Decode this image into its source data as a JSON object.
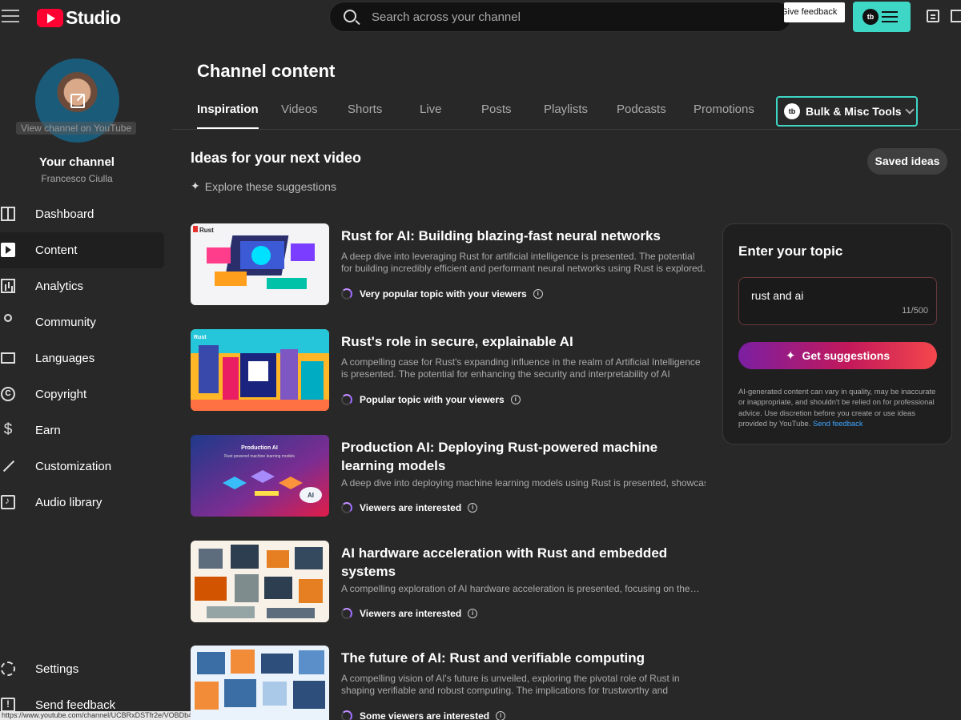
{
  "header": {
    "studio_label": "Studio",
    "search_placeholder": "Search across your channel",
    "give_feedback": "Give feedback"
  },
  "sidebar": {
    "view_on_youtube": "View channel on YouTube",
    "your_channel": "Your channel",
    "channel_name": "Francesco Ciulla",
    "items": [
      {
        "label": "Dashboard",
        "icon": "dashboard-icon"
      },
      {
        "label": "Content",
        "icon": "content-icon",
        "active": true
      },
      {
        "label": "Analytics",
        "icon": "analytics-icon"
      },
      {
        "label": "Community",
        "icon": "community-icon"
      },
      {
        "label": "Languages",
        "icon": "languages-icon"
      },
      {
        "label": "Copyright",
        "icon": "copyright-icon"
      },
      {
        "label": "Earn",
        "icon": "earn-icon"
      },
      {
        "label": "Customization",
        "icon": "customization-icon"
      },
      {
        "label": "Audio library",
        "icon": "audio-library-icon"
      }
    ],
    "bottom_items": [
      {
        "label": "Settings",
        "icon": "settings-icon"
      },
      {
        "label": "Send feedback",
        "icon": "send-feedback-icon"
      }
    ]
  },
  "status_url": "https://www.youtube.com/channel/UCBRxDSTfr2e/VOBDb4WC-Zg/",
  "main": {
    "page_title": "Channel content",
    "tabs": [
      "Inspiration",
      "Videos",
      "Shorts",
      "Live",
      "Posts",
      "Playlists",
      "Podcasts",
      "Promotions"
    ],
    "active_tab": "Inspiration",
    "bulk_tools_label": "Bulk & Misc Tools",
    "ideas_title": "Ideas for your next video",
    "explore_label": "Explore these suggestions",
    "saved_ideas_label": "Saved ideas"
  },
  "ideas": [
    {
      "title": "Rust for AI: Building blazing-fast neural networks",
      "description": "A deep dive into leveraging Rust for artificial intelligence is presented. The potential for building incredibly efficient and performant neural networks using Rust is explored.",
      "popularity": "Very popular topic with your viewers"
    },
    {
      "title": "Rust's role in secure, explainable AI",
      "description": "A compelling case for Rust's expanding influence in the realm of Artificial Intelligence is presented. The potential for enhancing the security and interpretability of AI systems…",
      "popularity": "Popular topic with your viewers"
    },
    {
      "title": "Production AI: Deploying Rust-powered machine learning models",
      "description": "A deep dive into deploying machine learning models using Rust is presented, showcasin…",
      "popularity": "Viewers are interested"
    },
    {
      "title": "AI hardware acceleration with Rust and embedded systems",
      "description": "A compelling exploration of AI hardware acceleration is presented, focusing on the…",
      "popularity": "Viewers are interested"
    },
    {
      "title": "The future of AI: Rust and verifiable computing",
      "description": "A compelling vision of AI's future is unveiled, exploring the pivotal role of Rust in shaping verifiable and robust computing. The implications for trustworthy and auditable AI…",
      "popularity": "Some viewers are interested"
    }
  ],
  "thumb_text": {
    "rust_tag": "Rust",
    "production_title": "Production AI",
    "production_sub": "Rust powered machine learning models",
    "ai_tag": "AI"
  },
  "topic_panel": {
    "title": "Enter your topic",
    "input_value": "rust and ai",
    "char_count": "11/500",
    "button_label": "Get suggestions",
    "disclaimer": "AI-generated content can vary in quality, may be inaccurate or inappropriate, and shouldn't be relied on for professional advice. Use discretion before you create or use ideas provided by YouTube.",
    "send_feedback": "Send feedback"
  },
  "colors": {
    "background": "#282828",
    "accent_teal": "#3ed6c4",
    "youtube_red": "#ff0033",
    "link_blue": "#3ea6ff",
    "gradient_start": "#7b1fa2",
    "gradient_end": "#f4474c"
  }
}
